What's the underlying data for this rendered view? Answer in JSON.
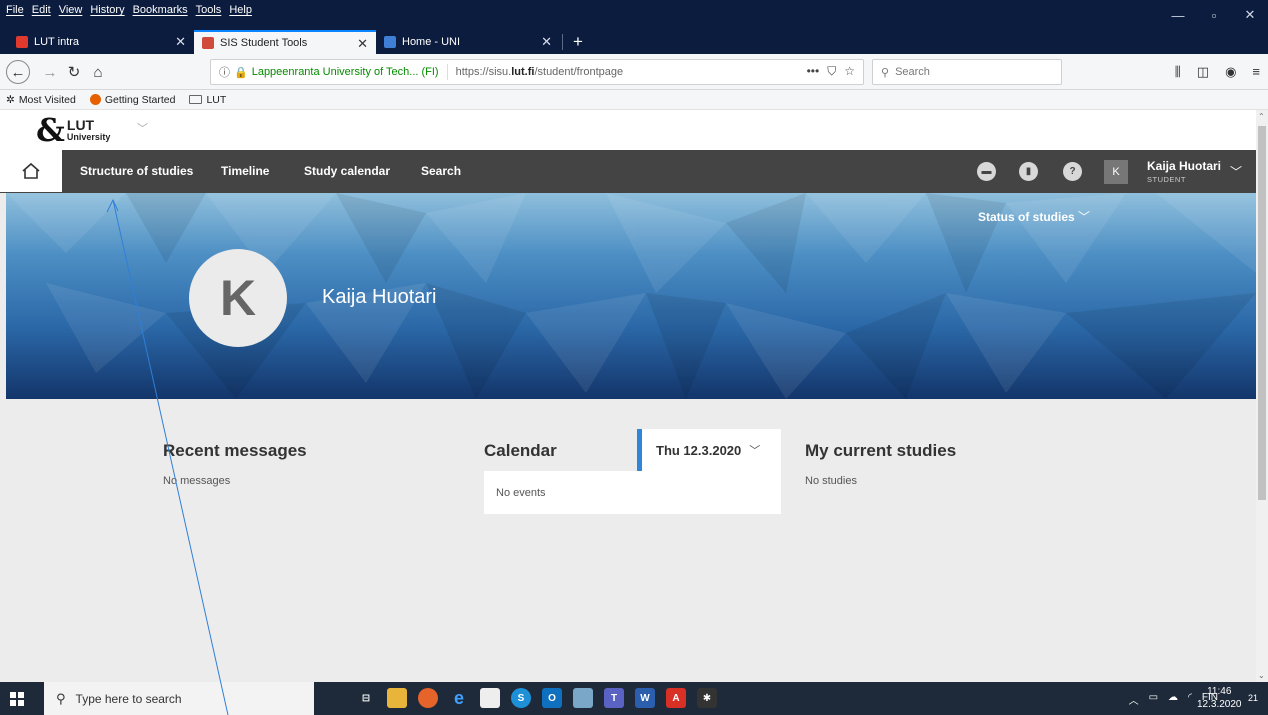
{
  "menubar": [
    "File",
    "Edit",
    "View",
    "History",
    "Bookmarks",
    "Tools",
    "Help"
  ],
  "window_controls": [
    "—",
    "▫",
    "✕"
  ],
  "tabs": [
    {
      "label": "LUT intra",
      "favicon_color": "#e03a2f"
    },
    {
      "label": "SIS Student Tools",
      "favicon_color": "#d04b3b"
    },
    {
      "label": "Home - UNI",
      "favicon_color": "#3f7fd6"
    }
  ],
  "address": {
    "site": "Lappeenranta University of Tech... (FI)",
    "url_prefix": "https://sisu.",
    "url_domain": "lut.fi",
    "url_suffix": "/student/frontpage"
  },
  "search_placeholder": "Search",
  "bookmarks": [
    "Most Visited",
    "Getting Started",
    "LUT"
  ],
  "app": {
    "logo_top": "LUT",
    "logo_bottom": "University",
    "nav": [
      "Structure of studies",
      "Timeline",
      "Study calendar",
      "Search"
    ],
    "user_initial": "K",
    "user_name": "Kaija Huotari",
    "user_role": "STUDENT",
    "status_of_studies": "Status of studies",
    "hero_name": "Kaija Huotari"
  },
  "sections": {
    "messages_title": "Recent messages",
    "messages_empty": "No messages",
    "calendar_title": "Calendar",
    "calendar_date": "Thu 12.3.2020",
    "calendar_empty": "No events",
    "studies_title": "My current studies",
    "studies_empty": "No studies"
  },
  "taskbar": {
    "search_placeholder": "Type here to search",
    "language": "FIN",
    "time": "11:46",
    "date": "12.3.2020",
    "notifications": "21"
  },
  "colors": {
    "accent_blue": "#2f86d8",
    "nav_bg": "#444444",
    "firefox_dark": "#0c1c3e"
  }
}
